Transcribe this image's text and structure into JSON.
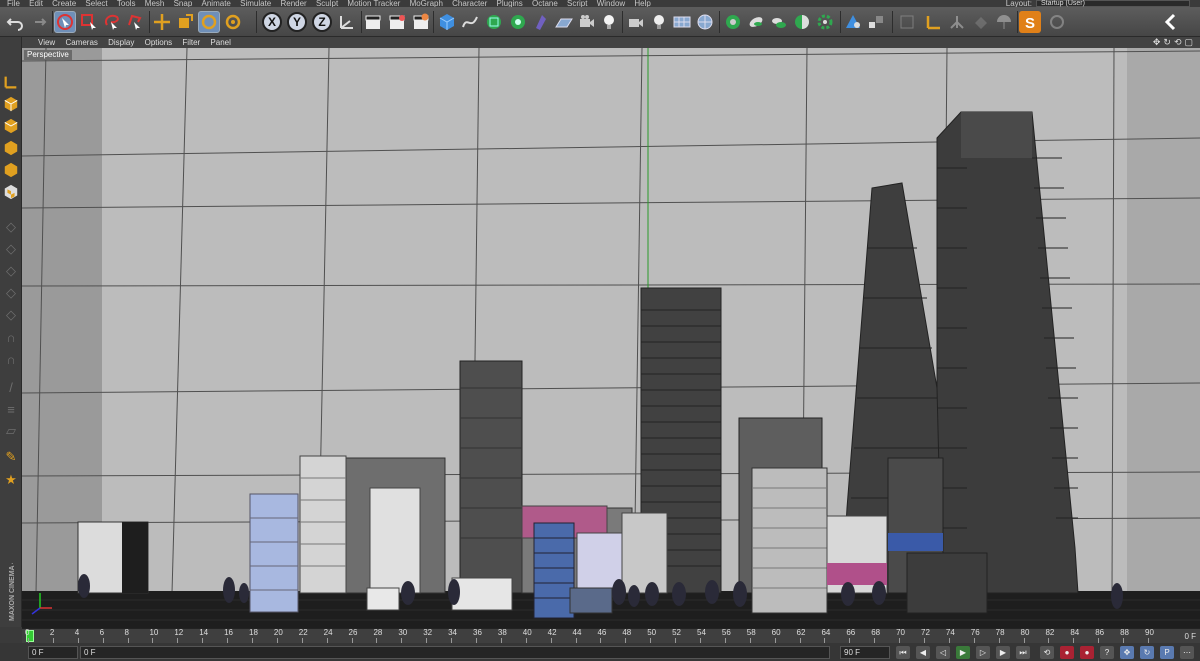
{
  "menubar": {
    "items": [
      "File",
      "Edit",
      "Create",
      "Select",
      "Tools",
      "Mesh",
      "Snap",
      "Animate",
      "Simulate",
      "Render",
      "Sculpt",
      "Motion Tracker",
      "MoGraph",
      "Character",
      "Plugins",
      "Octane",
      "Script",
      "Window",
      "Help"
    ],
    "layout_label": "Layout:",
    "layout_value": "Startup (User)"
  },
  "toolbar": {
    "axis_x": "X",
    "axis_y": "Y",
    "axis_z": "Z",
    "colors": {
      "accent": "#6f8fb8",
      "green": "#2fa84f",
      "orange": "#e0a020",
      "blue": "#3f8fe0"
    }
  },
  "viewport": {
    "menu": [
      "View",
      "Cameras",
      "Display",
      "Options",
      "Filter",
      "Panel"
    ],
    "label": "Perspective"
  },
  "timeline": {
    "ticks": [
      "0",
      "2",
      "4",
      "6",
      "8",
      "10",
      "12",
      "14",
      "16",
      "18",
      "20",
      "22",
      "24",
      "26",
      "28",
      "30",
      "32",
      "34",
      "36",
      "38",
      "40",
      "42",
      "44",
      "46",
      "48",
      "50",
      "52",
      "54",
      "56",
      "58",
      "60",
      "62",
      "64",
      "66",
      "68",
      "70",
      "72",
      "74",
      "76",
      "78",
      "80",
      "82",
      "84",
      "86",
      "88",
      "90"
    ],
    "current_frame": "0 F"
  },
  "transport": {
    "start": "0 F",
    "min": "0 F",
    "max": "90 F",
    "end": "90 F"
  },
  "brand": "MAXON CINEMA 4D"
}
